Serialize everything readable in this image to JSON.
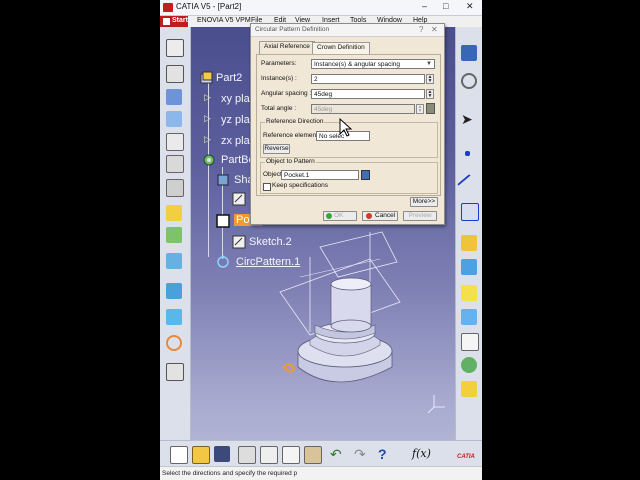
{
  "window": {
    "title": "CATIA V5 - [Part2]"
  },
  "menu": {
    "start": "Start",
    "items": [
      "ENOVIA V5 VPM",
      "File",
      "Edit",
      "View",
      "Insert",
      "Tools",
      "Window",
      "Help"
    ]
  },
  "tree": {
    "root": "Part2",
    "planes": [
      "xy pla",
      "yz pla",
      "zx pla"
    ],
    "body": "PartBo",
    "shaft": "Sha",
    "pocket": "Pock",
    "sketch": "Sketch.2",
    "pattern": "CircPattern.1"
  },
  "dialog": {
    "title": "Circular Pattern Definition",
    "tabs": [
      "Axial Reference",
      "Crown Definition"
    ],
    "parameters_label": "Parameters:",
    "parameters_value": "Instance(s) & angular spacing",
    "instances_label": "Instance(s) :",
    "instances_value": "2",
    "angular_label": "Angular spacing :",
    "angular_value": "45deg",
    "total_label": "Total angle :",
    "total_value": "45deg",
    "refdir_title": "Reference Direction",
    "refel_label": "Reference element:",
    "refel_value": "No selec",
    "reverse": "Reverse",
    "object_title": "Object to Pattern",
    "object_label": "Object:",
    "object_value": "Pocket.1",
    "keep_spec": "Keep specifications",
    "more": "More>>",
    "ok": "OK",
    "cancel": "Cancel",
    "preview": "Preview"
  },
  "status": "Select the directions and specify the required p",
  "brand": "CATIA",
  "colors": {
    "accent": "#c21b1b",
    "viewport": "#5c5e9c",
    "dialog": "#f0e7d6",
    "highlight": "#f39a2b"
  }
}
